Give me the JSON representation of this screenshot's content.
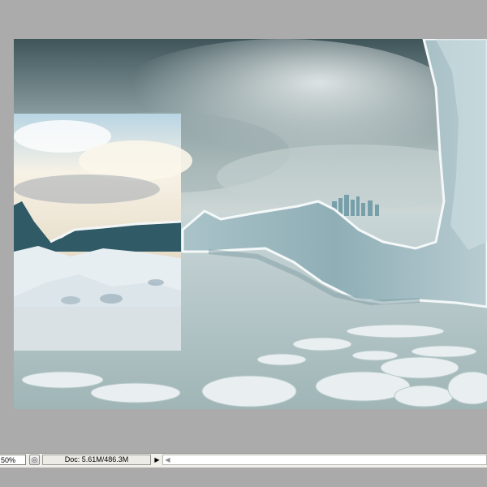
{
  "statusbar": {
    "zoom": "50%",
    "doc_info": "Doc: 5.61M/486.3M",
    "arrow_glyph": "▶",
    "scroll_left_glyph": "◀",
    "status_icon_glyph": "◎"
  },
  "icons": {
    "status": "status-indicator-icon",
    "menu_arrow": "triangle-right-icon",
    "scroll_left": "scroll-left-arrow-icon"
  },
  "colors": {
    "workspace": "#ababab",
    "statusbar": "#f0efe9",
    "sky_dark": "#4d6266",
    "ice": "#dfe8ea",
    "water": "#9fb6b8"
  }
}
